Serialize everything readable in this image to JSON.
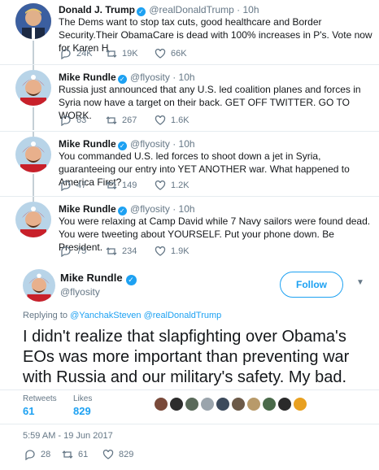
{
  "thread": [
    {
      "name": "Donald J. Trump",
      "handle": "@realDonaldTrump · 10h",
      "text": "The Dems want to stop tax cuts, good healthcare and Border Security.Their ObamaCare is dead with 100% increases in P's. Vote now for Karen H",
      "replies": "24K",
      "retweets": "19K",
      "likes": "66K"
    },
    {
      "name": "Mike Rundle",
      "handle": "@flyosity · 10h",
      "text": "Russia just announced that any U.S. led coalition planes and forces in Syria now have a target on their back. GET OFF TWITTER. GO TO WORK.",
      "replies": "63",
      "retweets": "267",
      "likes": "1.6K"
    },
    {
      "name": "Mike Rundle",
      "handle": "@flyosity · 10h",
      "text": "You commanded U.S. led forces to shoot down a jet in Syria, guaranteeing our entry into YET ANOTHER war. What happened to America First?",
      "replies": "47",
      "retweets": "149",
      "likes": "1.2K"
    },
    {
      "name": "Mike Rundle",
      "handle": "@flyosity · 10h",
      "text": "You were relaxing at Camp David while 7 Navy sailors were found dead. You were tweeting about YOURSELF. Put your phone down. Be President.",
      "replies": "75",
      "retweets": "234",
      "likes": "1.9K"
    }
  ],
  "main": {
    "name": "Mike Rundle",
    "handle": "@flyosity",
    "follow_label": "Follow",
    "reply_prefix": "Replying to ",
    "reply_to_1": "@YanchakSteven",
    "reply_to_2": "@realDonaldTrump",
    "text": "I didn't realize that slapfighting over Obama's EOs was more important than preventing war with Russia and our military's safety. My bad.",
    "retweets_label": "Retweets",
    "retweets": "61",
    "likes_label": "Likes",
    "likes": "829",
    "timestamp": "5:59 AM - 19 Jun 2017",
    "reply_count": "28",
    "retweet_count": "61",
    "like_count": "829"
  },
  "colors": {
    "accent": "#1da1f2",
    "muted": "#657786",
    "like_red": "#e0245e"
  }
}
